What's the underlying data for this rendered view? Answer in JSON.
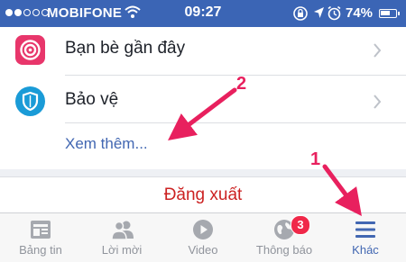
{
  "status_bar": {
    "carrier": "MOBIFONE",
    "time": "09:27",
    "battery": "74%",
    "battery_level": 0.74,
    "signal_bars_filled": 2,
    "signal_bars_total": 5,
    "icons": [
      "wifi-icon",
      "orientation-lock-icon",
      "location-arrow-icon",
      "alarm-icon",
      "battery-icon"
    ]
  },
  "menu": {
    "items": [
      {
        "label": "Bạn bè gần đây",
        "icon": "nearby-friends-icon",
        "color": "#e8366b"
      },
      {
        "label": "Bảo vệ",
        "icon": "shield-icon",
        "color": "#1a9bd7"
      }
    ],
    "see_more": "Xem thêm..."
  },
  "logout": "Đăng xuất",
  "tabbar": {
    "tabs": [
      {
        "label": "Bảng tin",
        "icon": "news-feed-icon"
      },
      {
        "label": "Lời mời",
        "icon": "friend-requests-icon"
      },
      {
        "label": "Video",
        "icon": "video-play-icon"
      },
      {
        "label": "Thông báo",
        "icon": "globe-notifications-icon",
        "badge": "3"
      },
      {
        "label": "Khác",
        "icon": "hamburger-menu-icon",
        "active": true
      }
    ]
  },
  "annotations": {
    "arrow_1_label": "1",
    "arrow_2_label": "2",
    "color": "#e8205e"
  }
}
